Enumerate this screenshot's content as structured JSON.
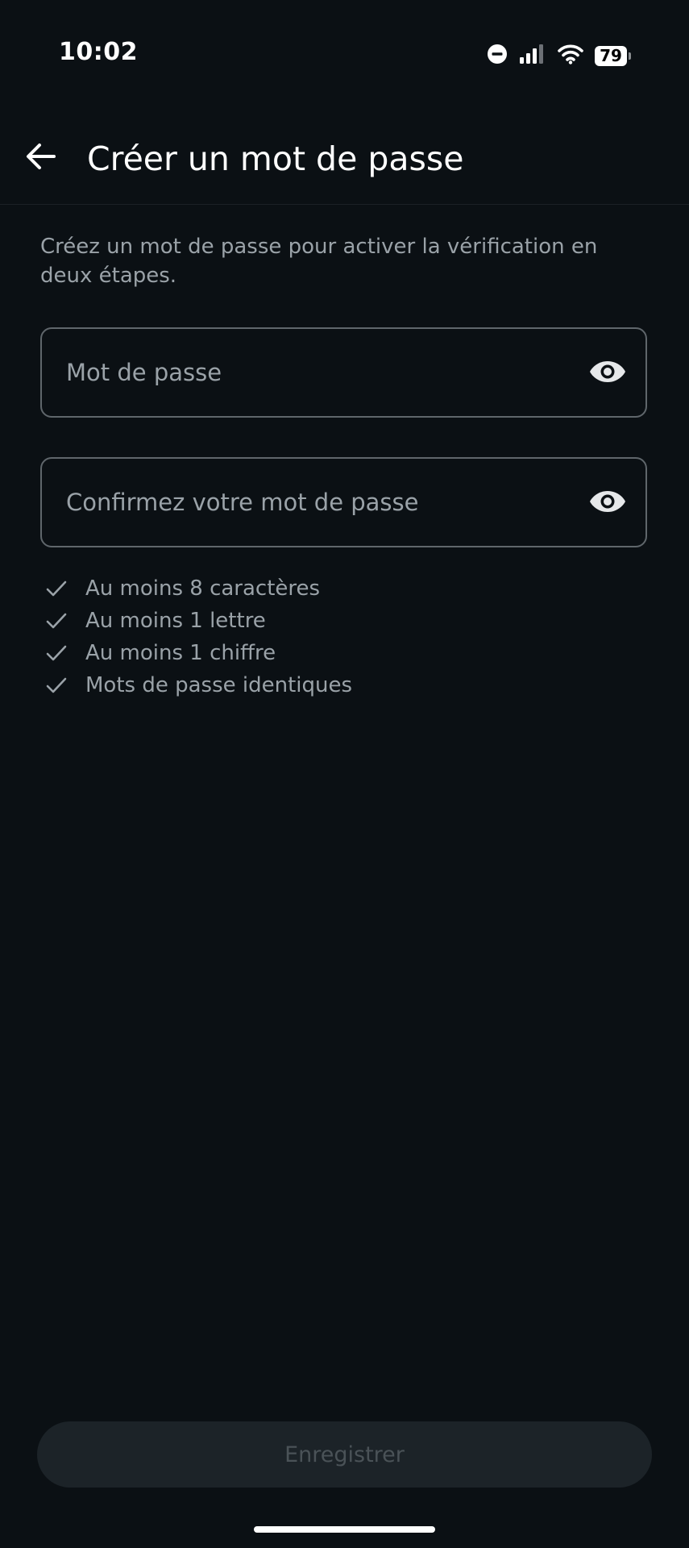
{
  "status_bar": {
    "time": "10:02",
    "battery_level": "79",
    "icons": [
      "do-not-disturb-icon",
      "signal-icon",
      "wifi-icon",
      "battery-icon"
    ]
  },
  "header": {
    "title": "Créer un mot de passe",
    "back_icon": "arrow-left-icon"
  },
  "description": "Créez un mot de passe pour activer la vérification en deux étapes.",
  "form": {
    "password": {
      "placeholder": "Mot de passe",
      "value": "",
      "toggle_icon": "eye-icon"
    },
    "confirm_password": {
      "placeholder": "Confirmez votre mot de passe",
      "value": "",
      "toggle_icon": "eye-icon"
    }
  },
  "requirements": [
    {
      "label": "Au moins 8 caractères",
      "icon": "check-icon"
    },
    {
      "label": "Au moins 1 lettre",
      "icon": "check-icon"
    },
    {
      "label": "Au moins 1 chiffre",
      "icon": "check-icon"
    },
    {
      "label": "Mots de passe identiques",
      "icon": "check-icon"
    }
  ],
  "actions": {
    "save_label": "Enregistrer",
    "save_enabled": false
  },
  "colors": {
    "background": "#0b1014",
    "secondary_text": "#9aa2a8",
    "field_border": "#5f666b",
    "disabled_button_bg": "#1c2328",
    "disabled_button_text": "#4a5257"
  }
}
